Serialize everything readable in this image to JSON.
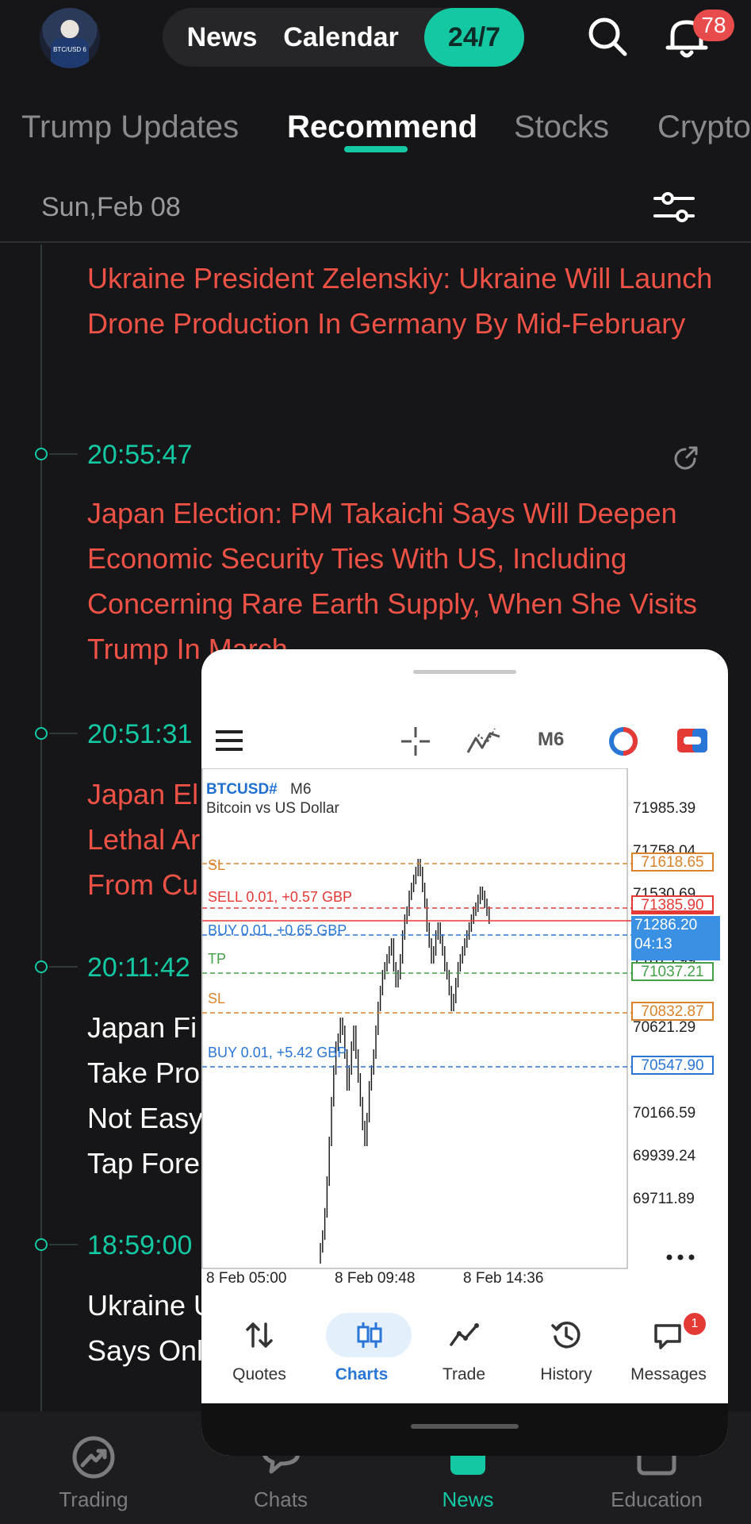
{
  "header": {
    "avatar_text": "BTC/USD 6",
    "segments": [
      "News",
      "Calendar",
      "24/7"
    ],
    "notification_count": "78"
  },
  "tabs": [
    "Trump Updates",
    "Recommend",
    "Stocks",
    "Crypto"
  ],
  "date": "Sun,Feb 08",
  "feed": [
    {
      "time": "",
      "headline": "Ukraine President Zelenskiy: Ukraine Will Launch Drone Production In Germany By Mid-February",
      "color": "red"
    },
    {
      "time": "20:55:47",
      "headline": "Japan Election: PM Takaichi Says Will Deepen Economic Security Ties With US, Including Concerning Rare Earth Supply, When She Visits Trump In March",
      "color": "red"
    },
    {
      "time": "20:51:31",
      "headline": "Japan El\nLethal Ar\nFrom Cu",
      "color": "red"
    },
    {
      "time": "20:11:42",
      "headline": "Japan Fi\nTake Pro\nNot Easy\nTap Fore",
      "color": "white"
    },
    {
      "time": "18:59:00",
      "headline": "Ukraine U\nSays Onl",
      "color": "white"
    }
  ],
  "bottom_nav": [
    "Trading",
    "Chats",
    "News",
    "Education"
  ],
  "mt": {
    "timeframe": "M6",
    "symbol": "BTCUSD#",
    "symbol_tf": "M6",
    "symbol_desc": "Bitcoin vs US Dollar",
    "lines": [
      {
        "label": "SL",
        "price": "71618.65",
        "color": "#d9822b"
      },
      {
        "label": "SELL 0.01,  +0.57 GBP",
        "price": "71385.90",
        "color": "#e53935"
      },
      {
        "label": "BUY 0.01,  +0.65 GBP",
        "price": "",
        "color": "#2a76d6"
      },
      {
        "label": "TP",
        "price": "71037.21",
        "color": "#43a047"
      },
      {
        "label": "SL",
        "price": "70832.87",
        "color": "#d9822b"
      },
      {
        "label": "BUY 0.01,  +5.42 GBP",
        "price": "70547.90",
        "color": "#2a76d6"
      }
    ],
    "bid": {
      "price": "71286.20",
      "countdown": "04:13"
    },
    "price_scale": [
      "71985.39",
      "71758.04",
      "71530.69",
      "71075.99",
      "70621.29",
      "70393.94",
      "70166.59",
      "69939.24",
      "69711.89"
    ],
    "time_axis": [
      "8 Feb 05:00",
      "8 Feb 09:48",
      "8 Feb 14:36"
    ],
    "nav": [
      "Quotes",
      "Charts",
      "Trade",
      "History",
      "Messages"
    ],
    "messages_badge": "1"
  }
}
